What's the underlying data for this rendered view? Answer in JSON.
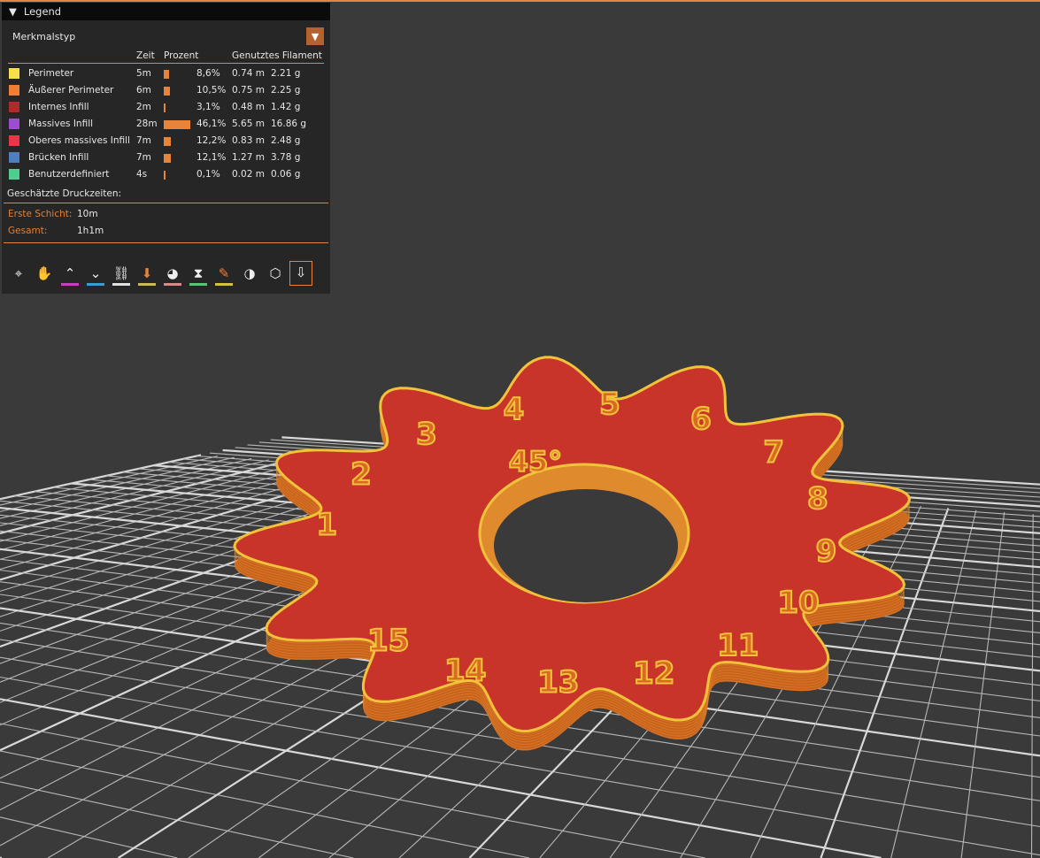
{
  "legend": {
    "title": "Legend",
    "view_type": "Merkmalstyp",
    "headers": {
      "time": "Zeit",
      "percent": "Prozent",
      "filament": "Genutztes Filament"
    },
    "rows": [
      {
        "label": "Perimeter",
        "color": "#f7e04a",
        "time": "5m",
        "pct": 8.6,
        "pct_text": "8,6%",
        "len": "0.74 m",
        "weight": "2.21 g"
      },
      {
        "label": "Äußerer Perimeter",
        "color": "#f07f33",
        "time": "6m",
        "pct": 10.5,
        "pct_text": "10,5%",
        "len": "0.75 m",
        "weight": "2.25 g"
      },
      {
        "label": "Internes Infill",
        "color": "#b02a2a",
        "time": "2m",
        "pct": 3.1,
        "pct_text": "3,1%",
        "len": "0.48 m",
        "weight": "1.42 g"
      },
      {
        "label": "Massives Infill",
        "color": "#9b4fd0",
        "time": "28m",
        "pct": 46.1,
        "pct_text": "46,1%",
        "len": "5.65 m",
        "weight": "16.86 g"
      },
      {
        "label": "Oberes massives Infill",
        "color": "#e8364a",
        "time": "7m",
        "pct": 12.2,
        "pct_text": "12,2%",
        "len": "0.83 m",
        "weight": "2.48 g"
      },
      {
        "label": "Brücken Infill",
        "color": "#4f7fbf",
        "time": "7m",
        "pct": 12.1,
        "pct_text": "12,1%",
        "len": "1.27 m",
        "weight": "3.78 g"
      },
      {
        "label": "Benutzerdefiniert",
        "color": "#4fcf8f",
        "time": "4s",
        "pct": 0.1,
        "pct_text": "0,1%",
        "len": "0.02 m",
        "weight": "0.06 g"
      }
    ],
    "estimates_title": "Geschätzte Druckzeiten:",
    "first_layer_label": "Erste Schicht:",
    "first_layer": "10m",
    "total_label": "Gesamt:",
    "total": "1h1m",
    "tools": [
      {
        "name": "travel-icon",
        "glyph": "⌖",
        "color": ""
      },
      {
        "name": "wipe-icon",
        "glyph": "✋",
        "color": ""
      },
      {
        "name": "retractions-icon",
        "glyph": "⌃",
        "color": "#c83cc8"
      },
      {
        "name": "deretractions-icon",
        "glyph": "⌄",
        "color": "#3c9ccf"
      },
      {
        "name": "seams-icon",
        "glyph": "⛓",
        "color": "#e0e0e0"
      },
      {
        "name": "tool-changes-icon",
        "glyph": "⬇",
        "color": "#c8b860"
      },
      {
        "name": "color-changes-icon",
        "glyph": "◕",
        "color": "#d88a8a"
      },
      {
        "name": "pause-icon",
        "glyph": "⧗",
        "color": "#50c878"
      },
      {
        "name": "custom-gcode-icon",
        "glyph": "✎",
        "color": "#d8c040"
      },
      {
        "name": "center-of-gravity-icon",
        "glyph": "◑",
        "color": ""
      },
      {
        "name": "shells-icon",
        "glyph": "⬡",
        "color": ""
      },
      {
        "name": "tool-marker-icon",
        "glyph": "⇩",
        "color": ""
      }
    ]
  },
  "model": {
    "labels": [
      "1",
      "2",
      "3",
      "4",
      "5",
      "6",
      "7",
      "8",
      "9",
      "10",
      "11",
      "12",
      "13",
      "14",
      "15"
    ],
    "center_label": "45°"
  }
}
